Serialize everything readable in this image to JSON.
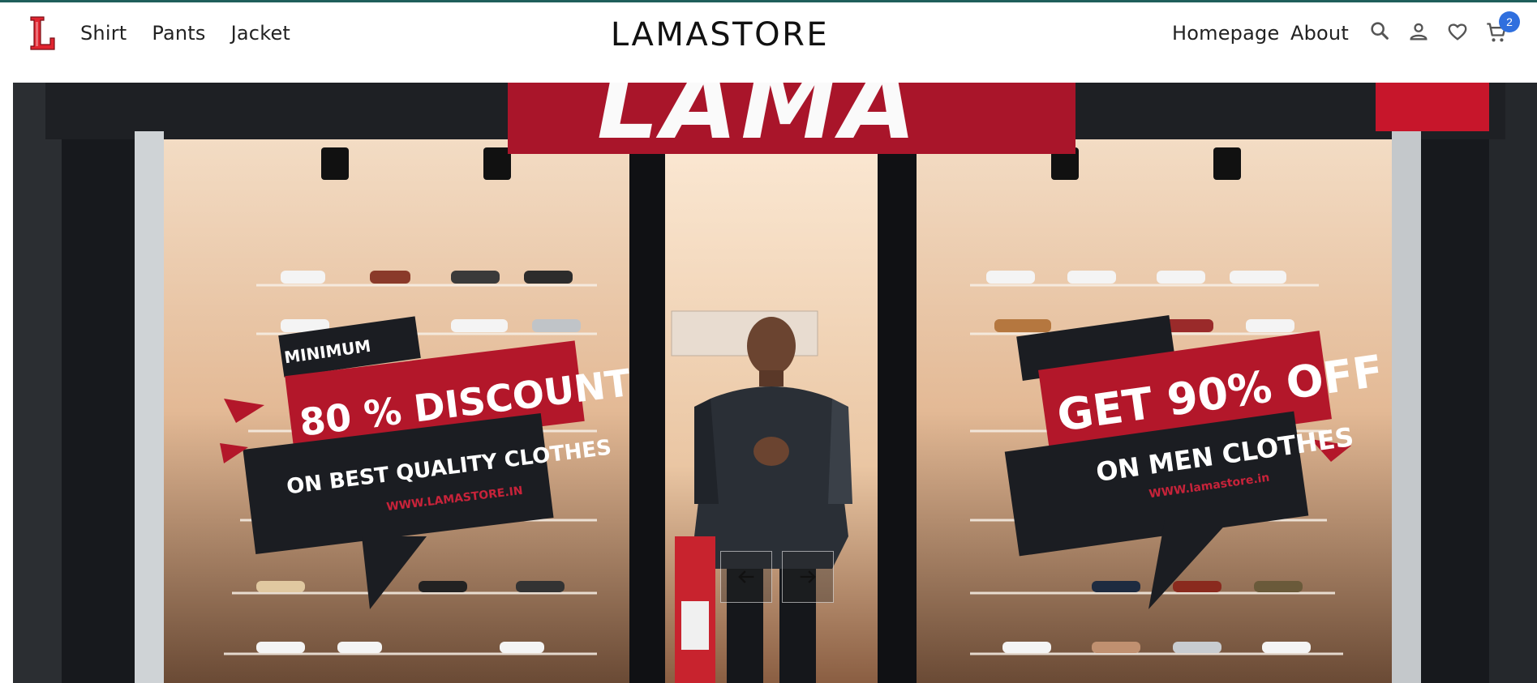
{
  "header": {
    "logo_letter": "L",
    "left_links": [
      "Shirt",
      "Pants",
      "Jacket"
    ],
    "brand": "LAMASTORE",
    "right_links": [
      "Homepage",
      "About"
    ],
    "icons": [
      "search-icon",
      "user-icon",
      "heart-icon",
      "cart-icon"
    ],
    "cart_count": "2",
    "accent_color": "#2f6fde",
    "logo_color": "#e0242f"
  },
  "hero": {
    "store_sign": "LAMA",
    "left_poster": {
      "top_tag": "MINIMUM",
      "headline": "80 % DISCOUNT",
      "subline": "ON BEST QUALITY CLOTHES",
      "url": "WWW.LAMASTORE.IN"
    },
    "right_poster": {
      "headline": "GET 90% OFF",
      "subline": "ON MEN CLOTHES",
      "url": "WWW.lamastore.in"
    },
    "prev_icon": "arrow-left-icon",
    "next_icon": "arrow-right-icon",
    "poster_red": "#b3172a",
    "poster_dark": "#1b1d22"
  }
}
